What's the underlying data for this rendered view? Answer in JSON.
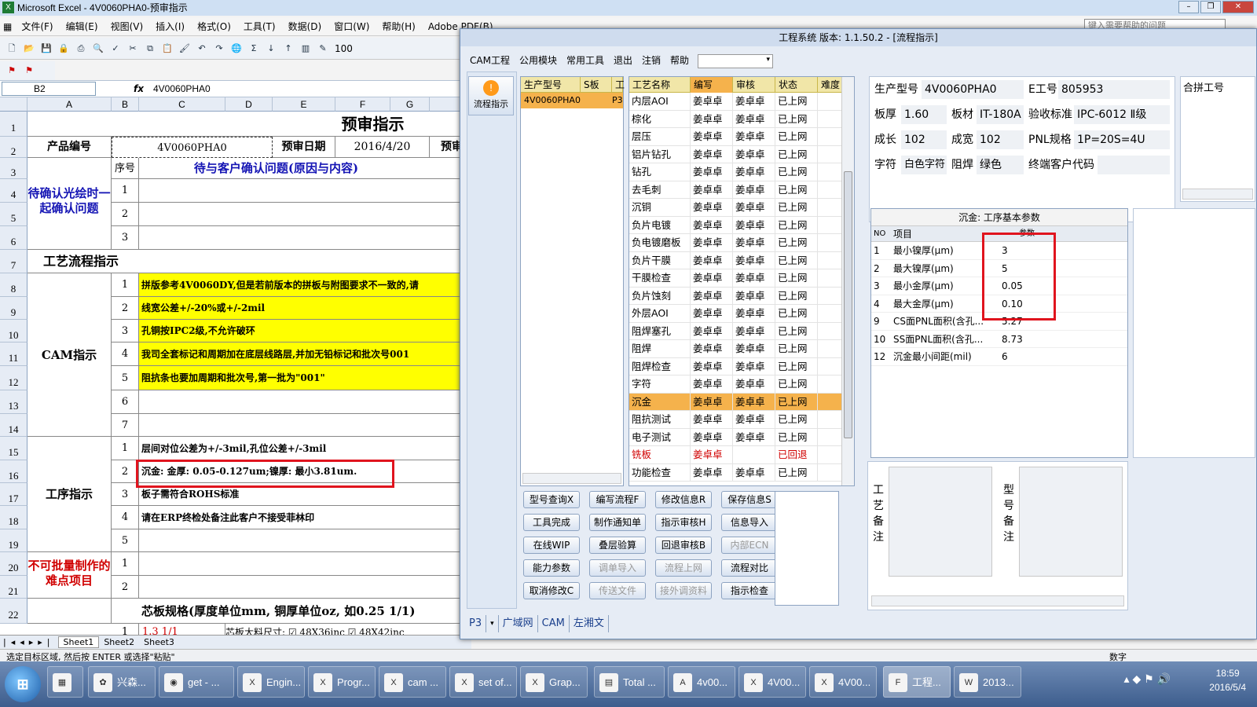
{
  "excel": {
    "title": "Microsoft Excel - 4V0060PHA0-预审指示",
    "menu": [
      "文件(F)",
      "编辑(E)",
      "视图(V)",
      "插入(I)",
      "格式(O)",
      "工具(T)",
      "数据(D)",
      "窗口(W)",
      "帮助(H)",
      "Adobe PDF(B)"
    ],
    "help_placeholder": "键入需要帮助的问题",
    "zoom": "100",
    "name_box": "B2",
    "fx": "fx",
    "formula": "4V0060PHA0",
    "columns": [
      "A",
      "B",
      "C",
      "D",
      "E",
      "F",
      "G"
    ],
    "rows": [
      "1",
      "2",
      "3",
      "4",
      "5",
      "6",
      "7",
      "8",
      "9",
      "10",
      "11",
      "12",
      "13",
      "14",
      "15",
      "16",
      "17",
      "18",
      "19",
      "20",
      "21",
      "22"
    ],
    "sheet_title": "预审指示",
    "product_label": "产品编号",
    "product_value": "4V0060PHA0",
    "prereview_date_label": "预审日期",
    "prereview_date": "2016/4/20",
    "prereview_cut": "预审",
    "index_label": "序号",
    "pending_header": "待与客户确认问题(原因与内容)",
    "pending_label": "待确认光绘时一起确认问题",
    "process_label": "工艺流程指示",
    "cam_label": "CAM指示",
    "proc_label": "工序指示",
    "difficult_label": "不可批量制作的难点项目",
    "core_spec": "芯板规格(厚度单位mm, 铜厚单位oz, 如0.25 1/1)",
    "core_row": "1.3 1/1",
    "core_size": "芯板大料尺寸: ☑ 48X36inc ☑ 48X42inc",
    "cam_items": [
      "拼版参考4V0060DY,但是若前版本的拼板与附图要求不一致的,请",
      "线宽公差+/-20%或+/-2mil",
      "孔铜按IPC2级,不允许破环",
      "我司全套标记和周期加在底层线路层,并加无铅标记和批次号001",
      "阻抗条也要加周期和批次号,第一批为\"001\""
    ],
    "proc_items": [
      "层间对位公差为+/-3mil,孔位公差+/-3mil",
      "沉金: 金厚: 0.05-0.127um;镍厚: 最小3.81um.",
      "板子需符合ROHS标准",
      "请在ERP终检处备注此客户不接受菲林印"
    ],
    "sheets": [
      "Sheet1",
      "Sheet2",
      "Sheet3"
    ],
    "status": "选定目标区域, 然后按 ENTER 或选择\"粘贴\"",
    "status_right": "数字"
  },
  "eng": {
    "title": "工程系统  版本: 1.1.50.2 - [流程指示]",
    "menu": [
      "CAM工程",
      "公用模块",
      "常用工具",
      "退出",
      "注销",
      "帮助"
    ],
    "side_label": "流程指示",
    "model_headers": [
      "生产型号",
      "S板",
      "工"
    ],
    "model_row": [
      "4V0060PHA0",
      "P3"
    ],
    "proc_headers": [
      "工艺名称",
      "编写",
      "审核",
      "状态",
      "难度"
    ],
    "processes": [
      [
        "内层AOI",
        "姜卓卓",
        "姜卓卓",
        "已上网"
      ],
      [
        "棕化",
        "姜卓卓",
        "姜卓卓",
        "已上网"
      ],
      [
        "层压",
        "姜卓卓",
        "姜卓卓",
        "已上网"
      ],
      [
        "铝片钻孔",
        "姜卓卓",
        "姜卓卓",
        "已上网"
      ],
      [
        "钻孔",
        "姜卓卓",
        "姜卓卓",
        "已上网"
      ],
      [
        "去毛刺",
        "姜卓卓",
        "姜卓卓",
        "已上网"
      ],
      [
        "沉铜",
        "姜卓卓",
        "姜卓卓",
        "已上网"
      ],
      [
        "负片电镀",
        "姜卓卓",
        "姜卓卓",
        "已上网"
      ],
      [
        "负电镀磨板",
        "姜卓卓",
        "姜卓卓",
        "已上网"
      ],
      [
        "负片干膜",
        "姜卓卓",
        "姜卓卓",
        "已上网"
      ],
      [
        "干膜检查",
        "姜卓卓",
        "姜卓卓",
        "已上网"
      ],
      [
        "负片蚀刻",
        "姜卓卓",
        "姜卓卓",
        "已上网"
      ],
      [
        "外层AOI",
        "姜卓卓",
        "姜卓卓",
        "已上网"
      ],
      [
        "阻焊塞孔",
        "姜卓卓",
        "姜卓卓",
        "已上网"
      ],
      [
        "阻焊",
        "姜卓卓",
        "姜卓卓",
        "已上网"
      ],
      [
        "阻焊检查",
        "姜卓卓",
        "姜卓卓",
        "已上网"
      ],
      [
        "字符",
        "姜卓卓",
        "姜卓卓",
        "已上网"
      ],
      [
        "沉金",
        "姜卓卓",
        "姜卓卓",
        "已上网"
      ],
      [
        "阻抗测试",
        "姜卓卓",
        "姜卓卓",
        "已上网"
      ],
      [
        "电子测试",
        "姜卓卓",
        "姜卓卓",
        "已上网"
      ],
      [
        "铣板",
        "姜卓卓",
        "",
        "已回退"
      ],
      [
        "功能检查",
        "姜卓卓",
        "姜卓卓",
        "已上网"
      ]
    ],
    "buttons": [
      [
        "型号查询X",
        "编写流程F",
        "修改信息R",
        "保存信息S"
      ],
      [
        "工具完成",
        "制作通知单",
        "指示审核H",
        "信息导入"
      ],
      [
        "在线WIP",
        "叠层验算",
        "回退审核B",
        "内部ECN"
      ],
      [
        "能力参数",
        "调单导入",
        "流程上网",
        "流程对比"
      ],
      [
        "取消修改C",
        "传送文件",
        "接外调资料",
        "指示检查"
      ]
    ],
    "info": {
      "model_label": "生产型号",
      "model": "4V0060PHA0",
      "e_label": "E工号",
      "e": "805953",
      "thick_label": "板厚",
      "thick": "1.60",
      "mat_label": "板材",
      "mat": "IT-180A",
      "std_label": "验收标准",
      "std": "IPC-6012 Ⅱ级",
      "len_label": "成长",
      "len": "102",
      "wid_label": "成宽",
      "wid": "102",
      "pnl_label": "PNL规格",
      "pnl": "1P=20S=4U",
      "char_label": "字符",
      "char": "白色字符",
      "mask_label": "阻焊",
      "mask": "绿色",
      "cust_label": "终端客户代码",
      "cust": "",
      "merge_label": "合拼工号"
    },
    "params_title": "沉金: 工序基本参数",
    "param_headers": [
      "NO",
      "项目",
      "参数"
    ],
    "params": [
      [
        "1",
        "最小镍厚(μm)",
        "3"
      ],
      [
        "2",
        "最大镍厚(μm)",
        "5"
      ],
      [
        "3",
        "最小金厚(μm)",
        "0.05"
      ],
      [
        "4",
        "最大金厚(μm)",
        "0.10"
      ],
      [
        "9",
        "CS面PNL面积(含孔...",
        "5.27"
      ],
      [
        "10",
        "SS面PNL面积(含孔...",
        "8.73"
      ],
      [
        "12",
        "沉金最小间距(mil)",
        "6"
      ]
    ],
    "remark1": "工艺备注",
    "remark2": "型号备注",
    "tabs": [
      "P3",
      "广域网",
      "CAM",
      "左湘文"
    ]
  },
  "taskbar": {
    "items": [
      "兴森...",
      "get - ...",
      "Engin...",
      "Progr...",
      "cam ...",
      "set of...",
      "Grap...",
      "Total ...",
      "4v00...",
      "4V00...",
      "4V00...",
      "工程...",
      "2013..."
    ],
    "time": "18:59",
    "date": "2016/5/4"
  }
}
